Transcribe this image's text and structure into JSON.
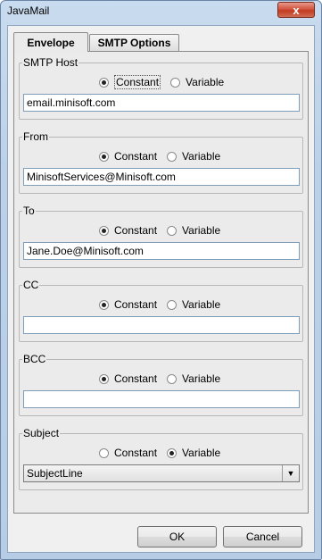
{
  "window": {
    "title": "JavaMail",
    "close_label": "x"
  },
  "tabs": [
    {
      "label": "Envelope",
      "active": true
    },
    {
      "label": "SMTP Options",
      "active": false
    }
  ],
  "groups": [
    {
      "legend": "SMTP Host",
      "constant_label": "Constant",
      "variable_label": "Variable",
      "selected": "constant",
      "value": "email.minisoft.com",
      "kind": "text"
    },
    {
      "legend": "From",
      "constant_label": "Constant",
      "variable_label": "Variable",
      "selected": "constant",
      "value": "MinisoftServices@Minisoft.com",
      "kind": "text"
    },
    {
      "legend": "To",
      "constant_label": "Constant",
      "variable_label": "Variable",
      "selected": "constant",
      "value": "Jane.Doe@Minisoft.com",
      "kind": "text"
    },
    {
      "legend": "CC",
      "constant_label": "Constant",
      "variable_label": "Variable",
      "selected": "constant",
      "value": "",
      "kind": "text"
    },
    {
      "legend": "BCC",
      "constant_label": "Constant",
      "variable_label": "Variable",
      "selected": "constant",
      "value": "",
      "kind": "text"
    },
    {
      "legend": "Subject",
      "constant_label": "Constant",
      "variable_label": "Variable",
      "selected": "variable",
      "value": "SubjectLine",
      "kind": "combo"
    }
  ],
  "buttons": {
    "ok_label": "OK",
    "cancel_label": "Cancel"
  },
  "icons": {
    "close": "close-icon",
    "dropdown": "chevron-down-icon"
  }
}
